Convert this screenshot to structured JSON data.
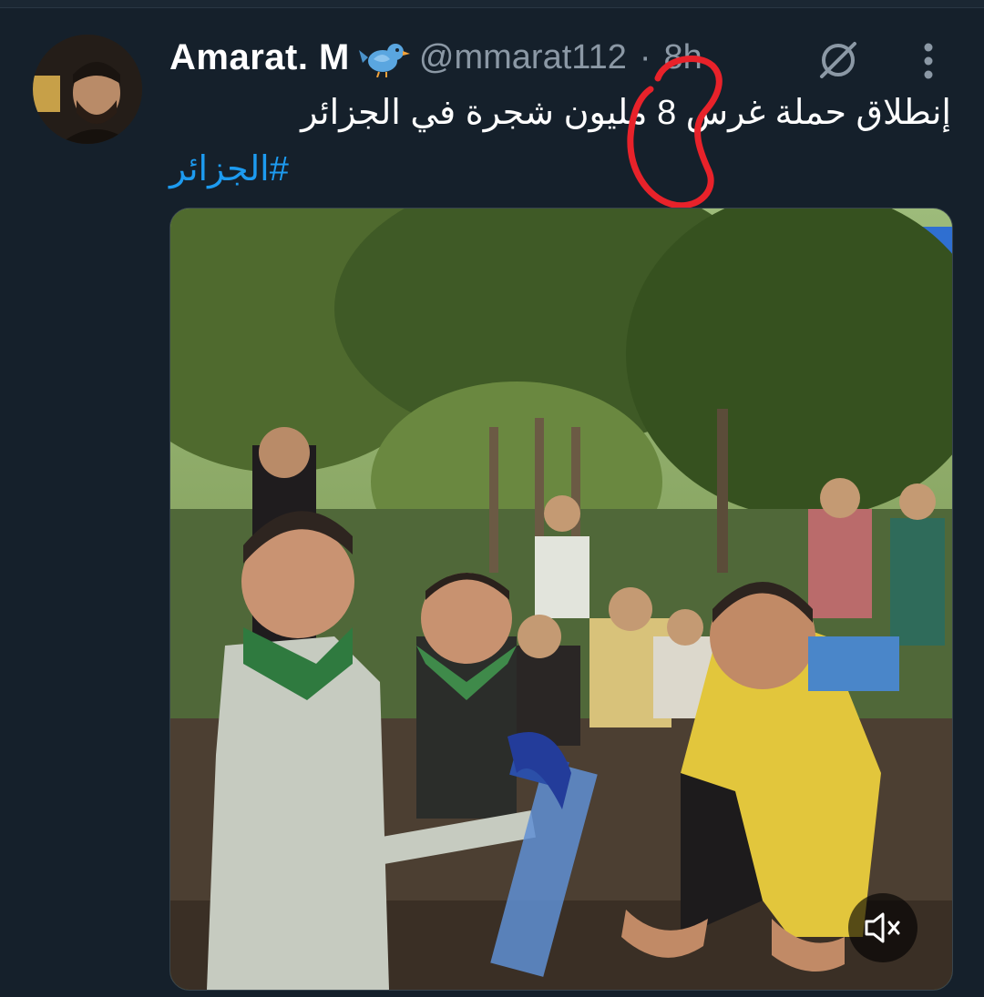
{
  "tweet": {
    "display_name": "Amarat. M",
    "handle": "@mmarat112",
    "separator": "·",
    "time": "8h",
    "text": "إنطلاق حملة غرس 8 مليون شجرة في الجزائر",
    "hashtag": "#الجزائر",
    "avatar_icon": "profile-photo",
    "bird_icon": "bird-emoji",
    "reply_icon": "reply-disabled-icon",
    "more_icon": "more-vertical-icon"
  },
  "media": {
    "type": "video",
    "mute_icon": "speaker-muted-icon"
  },
  "annotation": {
    "type": "red-circle",
    "color": "#e8222a"
  },
  "colors": {
    "background": "#15202b",
    "link": "#1d9bf0",
    "secondary": "#8b98a5"
  }
}
